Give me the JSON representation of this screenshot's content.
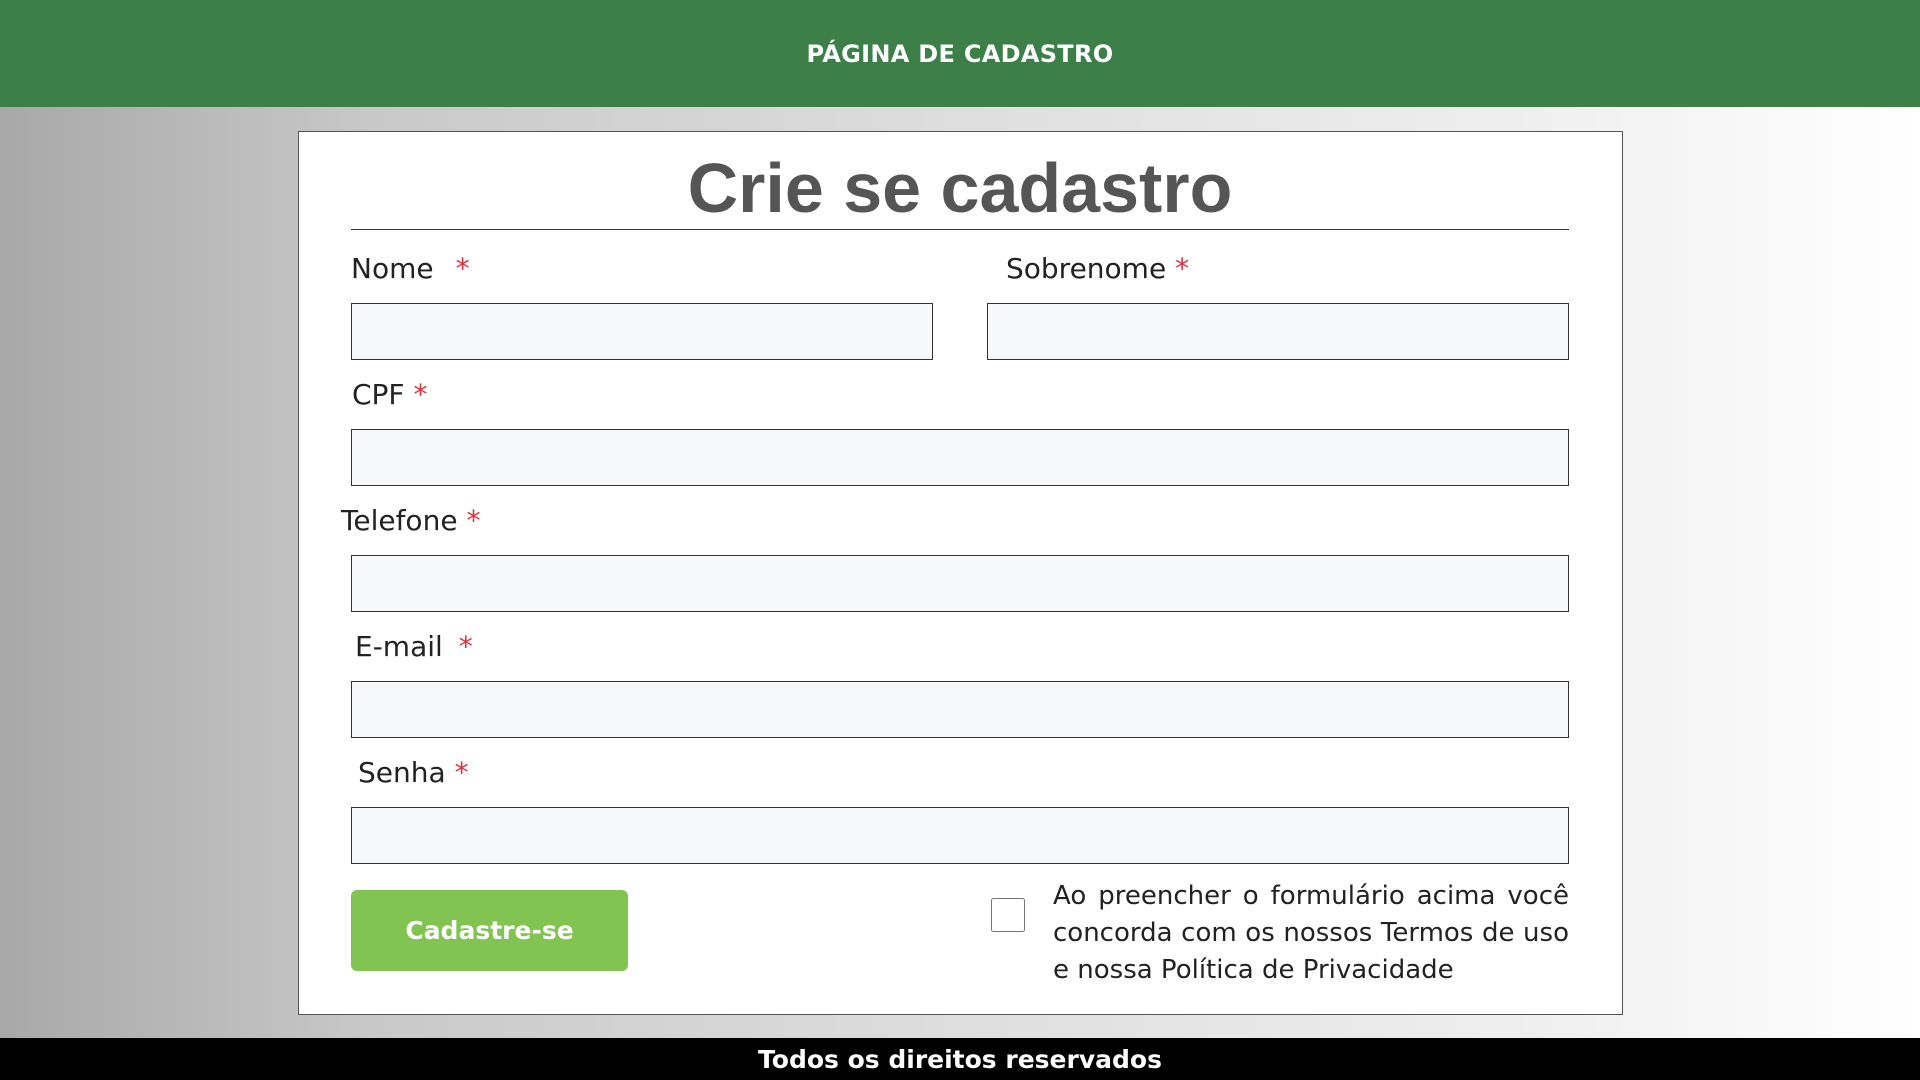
{
  "header": {
    "title": "PÁGINA DE CADASTRO"
  },
  "form": {
    "title": "Crie se cadastro",
    "required_marker": "*",
    "fields": {
      "nome": {
        "label": "Nome",
        "value": ""
      },
      "sobrenome": {
        "label": "Sobrenome",
        "value": ""
      },
      "cpf": {
        "label": "CPF",
        "value": ""
      },
      "telefone": {
        "label": "Telefone",
        "value": ""
      },
      "email": {
        "label": "E-mail",
        "value": ""
      },
      "senha": {
        "label": "Senha",
        "value": ""
      }
    },
    "submit_label": "Cadastre-se",
    "terms_text": "Ao preencher o formulário acima você concorda com os nossos Termos de uso e nossa Política de Privacidade",
    "terms_checked": false
  },
  "footer": {
    "text": "Todos os direitos reservados"
  },
  "colors": {
    "header_bg": "#3c7f49",
    "button_bg": "#82c451",
    "required": "#e0323a",
    "footer_bg": "#000000"
  }
}
